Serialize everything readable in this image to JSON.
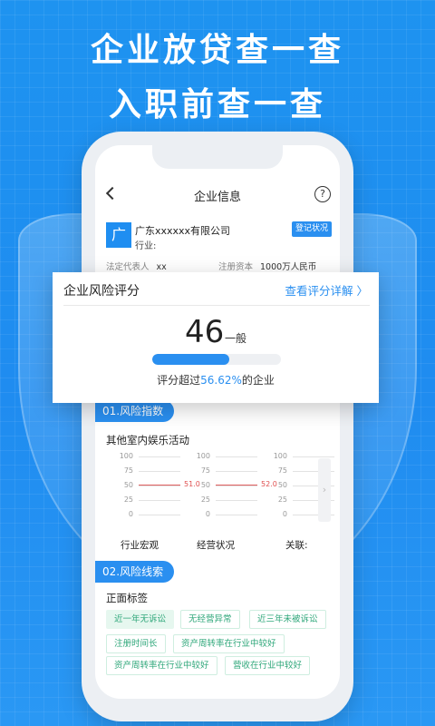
{
  "headline": {
    "line1": "企业放贷查一查",
    "line2": "入职前查一查"
  },
  "app": {
    "nav_title": "企业信息",
    "help_icon": "?",
    "company": {
      "logo_char": "广",
      "name": "广东xxxxxx有限公司",
      "industry_label": "行业:",
      "status_button": "登记状况",
      "legal_rep_label": "法定代表人",
      "legal_rep_value": "xx",
      "capital_label": "注册资本",
      "capital_value": "1000万人民币"
    },
    "risk_index": {
      "section_label": "01.风险指数",
      "subtitle": "其他室内娱乐活动",
      "chart_axis_ticks": [
        "100",
        "75",
        "50",
        "25",
        "0"
      ],
      "charts": [
        {
          "label": "行业宏观",
          "value": 51.0,
          "value_label": "51.0"
        },
        {
          "label": "经营状况",
          "value": 52.0,
          "value_label": "52.0"
        },
        {
          "label": "关联:",
          "value": null,
          "value_label": ""
        }
      ],
      "scroll_icon": "chevron-right-icon"
    },
    "risk_clues": {
      "section_label": "02.风险线索",
      "subtitle": "正面标签",
      "chips": [
        "近一年无诉讼",
        "无经营异常",
        "近三年未被诉讼",
        "注册时间长",
        "资产周转率在行业中较好",
        "资产周转率在行业中较好",
        "营收在行业中较好"
      ]
    }
  },
  "risk_card": {
    "title": "企业风险评分",
    "link": "查看评分详解 〉",
    "score": "46",
    "level": "一般",
    "progress_fraction": 0.6,
    "desc_prefix": "评分超过",
    "desc_pct": "56.62%",
    "desc_suffix": "的企业"
  },
  "colors": {
    "background": "#1f8ef1",
    "accent": "#2a8ff0",
    "chip_text": "#2fa77a",
    "reference_line": "#e06060"
  }
}
